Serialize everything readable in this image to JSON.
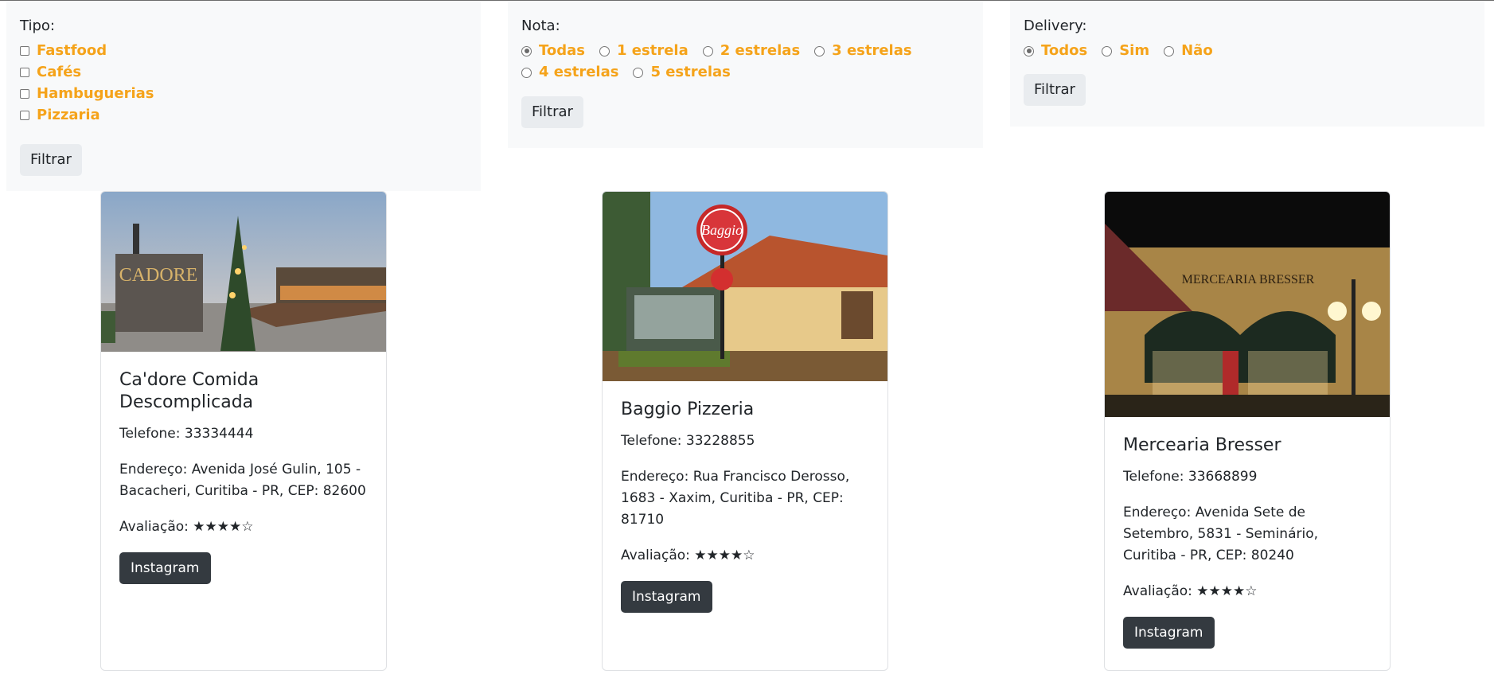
{
  "filters": {
    "tipo": {
      "title": "Tipo:",
      "options": [
        "Fastfood",
        "Cafés",
        "Hambuguerias",
        "Pizzaria"
      ],
      "button": "Filtrar"
    },
    "nota": {
      "title": "Nota:",
      "options": [
        "Todas",
        "1 estrela",
        "2 estrelas",
        "3 estrelas",
        "4 estrelas",
        "5 estrelas"
      ],
      "selected": "Todas",
      "button": "Filtrar"
    },
    "delivery": {
      "title": "Delivery:",
      "options": [
        "Todos",
        "Sim",
        "Não"
      ],
      "selected": "Todos",
      "button": "Filtrar"
    }
  },
  "restaurants": [
    {
      "name": "Ca'dore Comida Descomplicada",
      "phone": "Telefone: 33334444",
      "address": "Endereço: Avenida José Gulin, 105 - Bacacheri, Curitiba - PR, CEP: 82600",
      "rating": "Avaliação: ★★★★☆",
      "button": "Instagram",
      "photo_text": "CADORE"
    },
    {
      "name": "Baggio Pizzeria",
      "phone": "Telefone: 33228855",
      "address": "Endereço: Rua Francisco Derosso, 1683 - Xaxim, Curitiba - PR, CEP: 81710",
      "rating": "Avaliação: ★★★★☆",
      "button": "Instagram",
      "photo_text": "Baggio"
    },
    {
      "name": "Mercearia Bresser",
      "phone": "Telefone: 33668899",
      "address": "Endereço: Avenida Sete de Setembro, 5831 - Seminário, Curitiba - PR, CEP: 80240",
      "rating": "Avaliação: ★★★★☆",
      "button": "Instagram",
      "photo_text": "MERCEARIA BRESSER"
    }
  ],
  "colors": {
    "accent": "#f5a31a",
    "panel": "#f8f9fa",
    "dark_button": "#343a40"
  }
}
